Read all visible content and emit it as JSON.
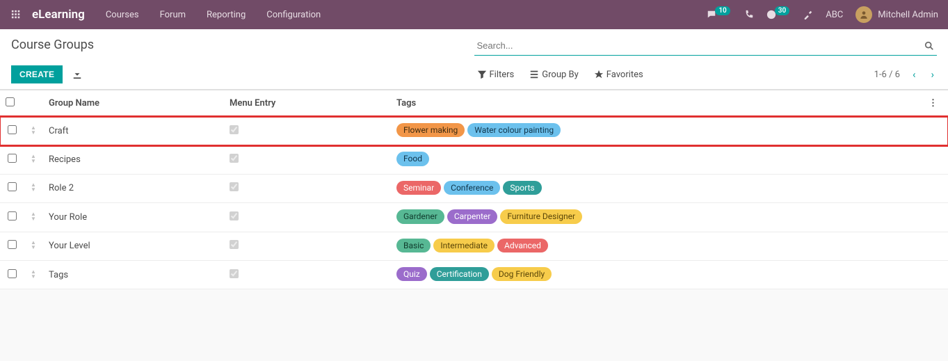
{
  "navbar": {
    "brand": "eLearning",
    "menu": [
      "Courses",
      "Forum",
      "Reporting",
      "Configuration"
    ],
    "chat_badge": "10",
    "activity_badge": "30",
    "company": "ABC",
    "user_name": "Mitchell Admin"
  },
  "breadcrumb": "Course Groups",
  "search": {
    "placeholder": "Search..."
  },
  "buttons": {
    "create": "CREATE"
  },
  "search_options": {
    "filters": "Filters",
    "group_by": "Group By",
    "favorites": "Favorites"
  },
  "pager": {
    "range": "1-6 / 6"
  },
  "columns": {
    "group_name": "Group Name",
    "menu_entry": "Menu Entry",
    "tags": "Tags"
  },
  "rows": [
    {
      "name": "Craft",
      "menu_entry": true,
      "highlighted": true,
      "tags": [
        {
          "label": "Flower making",
          "color": "orange"
        },
        {
          "label": "Water colour painting",
          "color": "sky"
        }
      ]
    },
    {
      "name": "Recipes",
      "menu_entry": true,
      "tags": [
        {
          "label": "Food",
          "color": "sky"
        }
      ]
    },
    {
      "name": "Role 2",
      "menu_entry": true,
      "tags": [
        {
          "label": "Seminar",
          "color": "red"
        },
        {
          "label": "Conference",
          "color": "sky"
        },
        {
          "label": "Sports",
          "color": "teal"
        }
      ]
    },
    {
      "name": "Your Role",
      "menu_entry": true,
      "tags": [
        {
          "label": "Gardener",
          "color": "green"
        },
        {
          "label": "Carpenter",
          "color": "purple"
        },
        {
          "label": "Furniture Designer",
          "color": "yellow"
        }
      ]
    },
    {
      "name": "Your Level",
      "menu_entry": true,
      "tags": [
        {
          "label": "Basic",
          "color": "green"
        },
        {
          "label": "Intermediate",
          "color": "yellow"
        },
        {
          "label": "Advanced",
          "color": "red"
        }
      ]
    },
    {
      "name": "Tags",
      "menu_entry": true,
      "tags": [
        {
          "label": "Quiz",
          "color": "purple"
        },
        {
          "label": "Certification",
          "color": "teal"
        },
        {
          "label": "Dog Friendly",
          "color": "yellow"
        }
      ]
    }
  ]
}
